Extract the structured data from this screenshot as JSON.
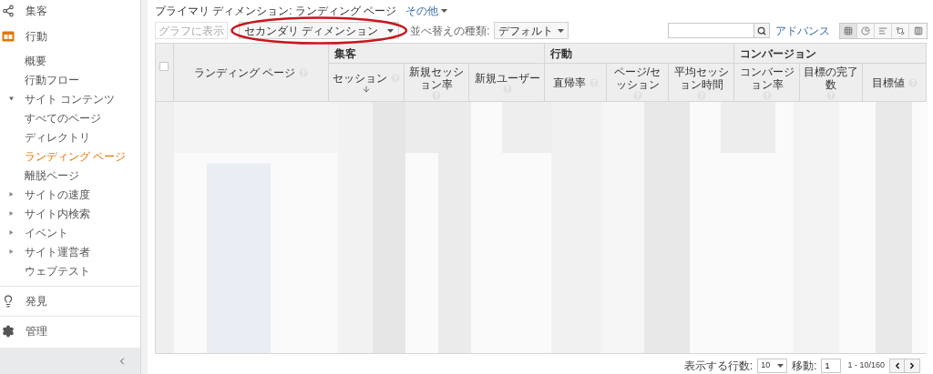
{
  "sidebar": {
    "items": [
      {
        "label": "集客",
        "selected": false
      },
      {
        "label": "行動",
        "selected": true,
        "children": [
          {
            "label": "概要",
            "selected": false
          },
          {
            "label": "行動フロー",
            "selected": false
          },
          {
            "label": "サイト コンテンツ",
            "selected": false,
            "expanded": true,
            "children": [
              {
                "label": "すべてのページ",
                "selected": false
              },
              {
                "label": "ディレクトリ",
                "selected": false
              },
              {
                "label": "ランディング ページ",
                "selected": true
              },
              {
                "label": "離脱ページ",
                "selected": false
              }
            ]
          },
          {
            "label": "サイトの速度",
            "selected": false,
            "expanded": false
          },
          {
            "label": "サイト内検索",
            "selected": false,
            "expanded": false
          },
          {
            "label": "イベント",
            "selected": false,
            "expanded": false
          },
          {
            "label": "サイト運営者",
            "selected": false,
            "expanded": false
          },
          {
            "label": "ウェブテスト",
            "selected": false
          }
        ]
      },
      {
        "label": "発見",
        "selected": false
      },
      {
        "label": "管理",
        "selected": false
      }
    ]
  },
  "dimension_bar": {
    "primary": "プライマリ ディメンション: ランディング ページ",
    "other": "その他"
  },
  "toolbar": {
    "plot_button": {
      "label": "グラフに表示",
      "disabled": true
    },
    "secondary_dimension": "セカンダリ ディメンション",
    "sort_label": "並べ替えの種類:",
    "sort_type": "デフォルト",
    "advanced": "アドバンス",
    "views": [
      {
        "selected": true
      },
      {
        "selected": false
      },
      {
        "selected": false
      },
      {
        "selected": false
      },
      {
        "selected": false
      }
    ]
  },
  "table": {
    "select_all": {
      "checked": false
    },
    "dimension_column": "ランディング ページ",
    "groups": [
      {
        "label": "集客",
        "columns": [
          {
            "label": "セッション",
            "sorted": true
          },
          {
            "label": "新規セッション率",
            "sorted": false
          },
          {
            "label": "新規ユーザー",
            "sorted": false
          }
        ]
      },
      {
        "label": "行動",
        "columns": [
          {
            "label": "直帰率",
            "sorted": false
          },
          {
            "label": "ページ/セッション",
            "sorted": false
          },
          {
            "label": "平均セッション時間",
            "sorted": false
          }
        ]
      },
      {
        "label": "コンバージョン",
        "columns": [
          {
            "label": "コンバージョン率",
            "sorted": false
          },
          {
            "label": "目標の完了数",
            "sorted": false
          },
          {
            "label": "目標値",
            "sorted": false
          }
        ]
      }
    ]
  },
  "pagination": {
    "rows_label": "表示する行数:",
    "rows_value": "10",
    "goto_label": "移動:",
    "goto_value": "1",
    "range": "1 - 10/160"
  },
  "annotation": {
    "kind": "ellipse"
  }
}
